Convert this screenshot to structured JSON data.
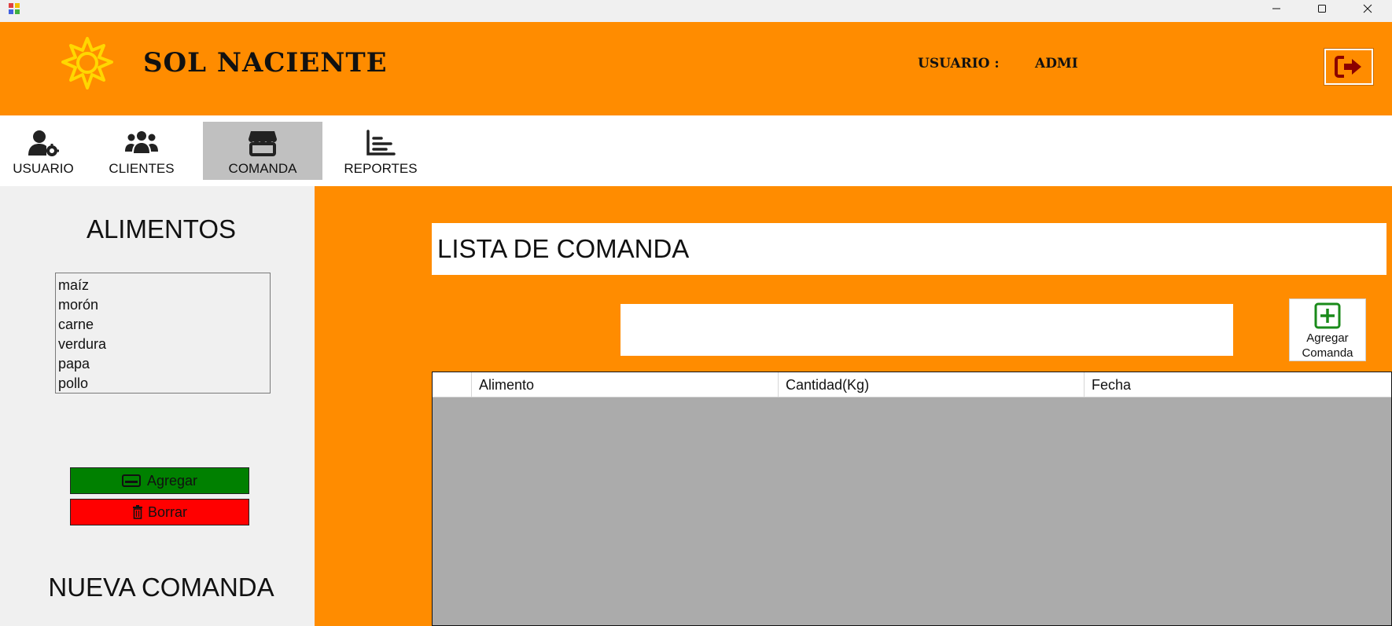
{
  "window": {
    "controls": [
      "minimize",
      "maximize",
      "close"
    ]
  },
  "header": {
    "brand": "SOL NACIENTE",
    "user_label": "USUARIO :",
    "user_value": "ADMI",
    "accent": "#ff8c00"
  },
  "nav": {
    "items": [
      {
        "label": "USUARIO",
        "icon": "user-gear-icon",
        "active": false
      },
      {
        "label": "CLIENTES",
        "icon": "users-icon",
        "active": false
      },
      {
        "label": "COMANDA",
        "icon": "store-icon",
        "active": true
      },
      {
        "label": "REPORTES",
        "icon": "chart-icon",
        "active": false
      }
    ]
  },
  "left": {
    "title": "ALIMENTOS",
    "items": [
      "maíz",
      "morón",
      "carne",
      "verdura",
      "papa",
      "pollo"
    ],
    "add_label": "Agregar",
    "delete_label": "Borrar",
    "bottom_title": "NUEVA COMANDA"
  },
  "main": {
    "list_title": "LISTA DE COMANDA",
    "search_value": "",
    "add_button": {
      "line1": "Agregar",
      "line2": "Comanda"
    },
    "grid": {
      "columns": [
        "",
        "Alimento",
        "Cantidad(Kg)",
        "Fecha"
      ],
      "rows": []
    }
  }
}
